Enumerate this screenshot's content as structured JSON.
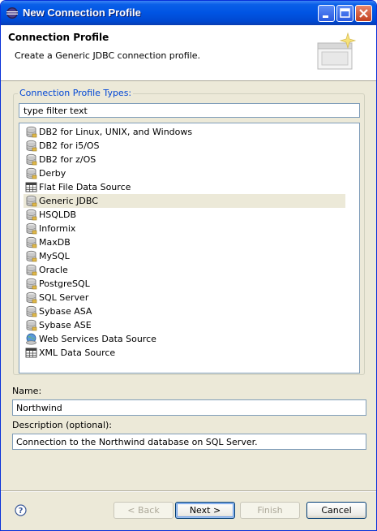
{
  "window": {
    "title": "New Connection Profile"
  },
  "banner": {
    "heading": "Connection Profile",
    "description": "Create a Generic JDBC connection profile."
  },
  "profile_types": {
    "group_title": "Connection Profile Types:",
    "filter_text": "type filter text",
    "selected_index": 5,
    "items": [
      {
        "label": "DB2 for Linux, UNIX, and Windows",
        "icon": "database-icon"
      },
      {
        "label": "DB2 for i5/OS",
        "icon": "database-icon"
      },
      {
        "label": "DB2 for z/OS",
        "icon": "database-icon"
      },
      {
        "label": "Derby",
        "icon": "database-icon"
      },
      {
        "label": "Flat File Data Source",
        "icon": "table-icon"
      },
      {
        "label": "Generic JDBC",
        "icon": "database-icon"
      },
      {
        "label": "HSQLDB",
        "icon": "database-icon"
      },
      {
        "label": "Informix",
        "icon": "database-icon"
      },
      {
        "label": "MaxDB",
        "icon": "database-icon"
      },
      {
        "label": "MySQL",
        "icon": "database-icon"
      },
      {
        "label": "Oracle",
        "icon": "database-icon"
      },
      {
        "label": "PostgreSQL",
        "icon": "database-icon"
      },
      {
        "label": "SQL Server",
        "icon": "database-icon"
      },
      {
        "label": "Sybase ASA",
        "icon": "database-icon"
      },
      {
        "label": "Sybase ASE",
        "icon": "database-icon"
      },
      {
        "label": "Web Services Data Source",
        "icon": "web-services-icon"
      },
      {
        "label": "XML Data Source",
        "icon": "table-icon"
      }
    ]
  },
  "name": {
    "label": "Name:",
    "value": "Northwind"
  },
  "description": {
    "label": "Description (optional):",
    "value": "Connection to the Northwind database on  SQL Server."
  },
  "buttons": {
    "back": "< Back",
    "next": "Next >",
    "finish": "Finish",
    "cancel": "Cancel"
  },
  "colors": {
    "titlebar": "#0054e3",
    "group_title": "#0046d5",
    "selection": "#ece9d8"
  }
}
